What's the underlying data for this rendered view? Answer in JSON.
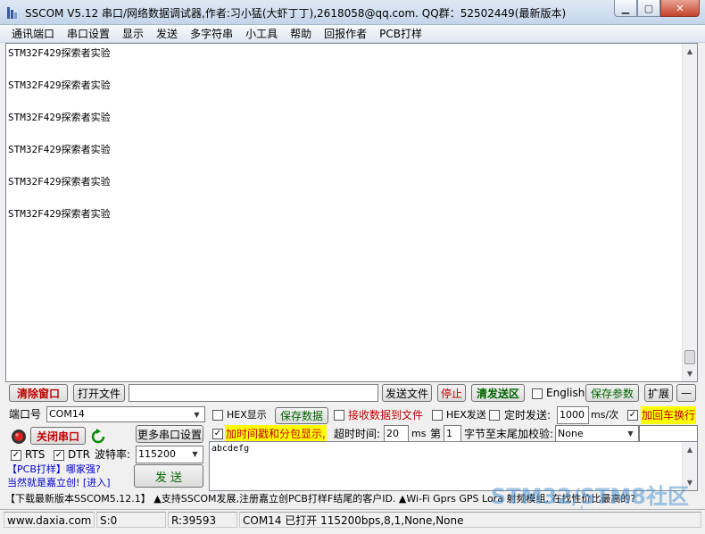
{
  "window": {
    "title": "SSCOM V5.12 串口/网络数据调试器,作者:习小猛(大虾丁丁),2618058@qq.com. QQ群：52502449(最新版本)",
    "minimize": "▁",
    "maximize": "▢",
    "close": "✕"
  },
  "menu": [
    "通讯端口",
    "串口设置",
    "显示",
    "发送",
    "多字符串",
    "小工具",
    "帮助",
    "回报作者",
    "PCB打样"
  ],
  "receive": {
    "lines": [
      "STM32F429探索者实验",
      "",
      "STM32F429探索者实验",
      "",
      "STM32F429探索者实验",
      "",
      "STM32F429探索者实验",
      "",
      "STM32F429探索者实验",
      "",
      "STM32F429探索者实验"
    ]
  },
  "toolbar": {
    "clear_window": "清除窗口",
    "open_file": "打开文件",
    "file_path": "",
    "send_file": "发送文件",
    "stop": "停止",
    "clear_send": "清发送区",
    "english": "English",
    "save_params": "保存参数",
    "expand": "扩展",
    "collapse": "—"
  },
  "port": {
    "port_label": "端口号",
    "port_value": "COM14",
    "close_port": "关闭串口",
    "more_settings": "更多串口设置",
    "rts": "RTS",
    "dtr": "DTR",
    "baud_label": "波特率:",
    "baud_value": "115200",
    "promo1": "【PCB打样】哪家强?",
    "promo2": "当然就是嘉立创! [进入]",
    "send_button": "发  送"
  },
  "options": {
    "hex_display": "HEX显示",
    "save_data": "保存数据",
    "recv_to_file": "接收数据到文件",
    "hex_send": "HEX发送",
    "timed_send": "定时发送:",
    "interval": "1000",
    "interval_unit": "ms/次",
    "add_crlf": "加回车换行",
    "timestamp": "加时间戳和分包显示,",
    "timeout_label": "超时时间:",
    "timeout_value": "20",
    "timeout_unit": "ms",
    "byte_label_pre": "第",
    "byte_value": "1",
    "byte_label_post": "字节至末尾加校验:",
    "checksum": "None"
  },
  "send_area": {
    "text": "abcdefg"
  },
  "ad_bar": "【下载最新版本SSCOM5.12.1】  ▲支持SSCOM发展,注册嘉立创PCB打样F结尾的客户ID.  ▲Wi-Fi Gprs GPS Lora 射频模组, 在找性价比最高的?",
  "watermark": {
    "line1": "STM32/STM8社区",
    "line2": "www.stmcu.org"
  },
  "status": {
    "website": "www.daxia.com",
    "sent": "S:0",
    "received": "R:39593",
    "port_status": "COM14 已打开  115200bps,8,1,None,None"
  },
  "icons": {
    "app": "sscom-app-icon",
    "refresh": "refresh-icon",
    "port_led": "port-led-icon"
  },
  "colors": {
    "highlight": "#ffff00",
    "red_label": "#c00000",
    "green_label": "#006400",
    "link_blue": "#0000cc"
  }
}
